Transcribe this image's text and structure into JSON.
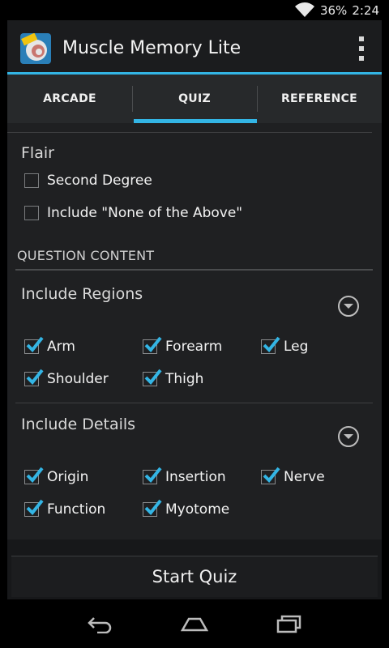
{
  "status_bar": {
    "battery": "36%",
    "time": "2:24"
  },
  "app": {
    "title": "Muscle Memory Lite",
    "icon": "brain-lite-logo",
    "menu_icon": "overflow-menu-icon"
  },
  "tabs": [
    {
      "label": "ARCADE",
      "selected": false
    },
    {
      "label": "QUIZ",
      "selected": true
    },
    {
      "label": "REFERENCE",
      "selected": false
    }
  ],
  "flair": {
    "title": "Flair",
    "options": [
      {
        "label": "Second Degree",
        "checked": false
      },
      {
        "label": "Include \"None of the Above\"",
        "checked": false
      }
    ]
  },
  "question_content": {
    "header": "QUESTION CONTENT"
  },
  "regions": {
    "title": "Include Regions",
    "items": [
      {
        "label": "Arm",
        "checked": true
      },
      {
        "label": "Forearm",
        "checked": true
      },
      {
        "label": "Leg",
        "checked": true
      },
      {
        "label": "Shoulder",
        "checked": true
      },
      {
        "label": "Thigh",
        "checked": true
      }
    ]
  },
  "details": {
    "title": "Include Details",
    "items": [
      {
        "label": "Origin",
        "checked": true
      },
      {
        "label": "Insertion",
        "checked": true
      },
      {
        "label": "Nerve",
        "checked": true
      },
      {
        "label": "Function",
        "checked": true
      },
      {
        "label": "Myotome",
        "checked": true
      }
    ]
  },
  "start_button": {
    "label": "Start Quiz"
  },
  "colors": {
    "accent": "#33b5e5",
    "background": "#1f2022",
    "action_bar": "#1b1c1e"
  },
  "nav": {
    "back": "back-icon",
    "home": "home-icon",
    "recents": "recents-icon"
  }
}
